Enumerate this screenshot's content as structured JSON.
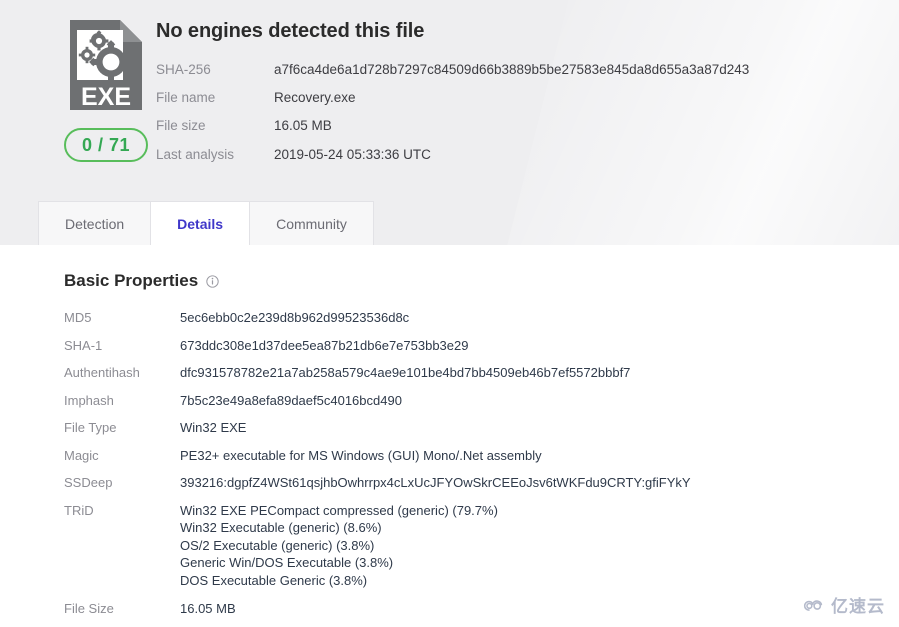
{
  "header": {
    "headline": "No engines detected this file",
    "file_icon_label": "EXE",
    "score": "0 / 71",
    "score_color": "#34a853",
    "meta": [
      {
        "key": "SHA-256",
        "value": "a7f6ca4de6a1d728b7297c84509d66b3889b5be27583e845da8d655a3a87d243"
      },
      {
        "key": "File name",
        "value": "Recovery.exe"
      },
      {
        "key": "File size",
        "value": "16.05 MB"
      },
      {
        "key": "Last analysis",
        "value": "2019-05-24 05:33:36 UTC"
      }
    ]
  },
  "tabs": [
    {
      "label": "Detection",
      "active": false
    },
    {
      "label": "Details",
      "active": true
    },
    {
      "label": "Community",
      "active": false
    }
  ],
  "tab_active_color": "#3f37c9",
  "details": {
    "section_title": "Basic Properties",
    "info_icon": "info-icon",
    "properties": [
      {
        "key": "MD5",
        "value": "5ec6ebb0c2e239d8b962d99523536d8c"
      },
      {
        "key": "SHA-1",
        "value": "673ddc308e1d37dee5ea87b21db6e7e753bb3e29"
      },
      {
        "key": "Authentihash",
        "value": "dfc931578782e21a7ab258a579c4ae9e101be4bd7bb4509eb46b7ef5572bbbf7"
      },
      {
        "key": "Imphash",
        "value": "7b5c23e49a8efa89daef5c4016bcd490"
      },
      {
        "key": "File Type",
        "value": "Win32 EXE"
      },
      {
        "key": "Magic",
        "value": "PE32+ executable for MS Windows (GUI) Mono/.Net assembly"
      },
      {
        "key": "SSDeep",
        "value": "393216:dgpfZ4WSt61qsjhbOwhrrpx4cLxUcJFYOwSkrCEEoJsv6tWKFdu9CRTY:gfiFYkY"
      }
    ],
    "trid_key": "TRiD",
    "trid_values": [
      "Win32 EXE PECompact compressed (generic) (79.7%)",
      "Win32 Executable (generic) (8.6%)",
      "OS/2 Executable (generic) (3.8%)",
      "Generic Win/DOS Executable (3.8%)",
      "DOS Executable Generic (3.8%)"
    ],
    "file_size_key": "File Size",
    "file_size_value": "16.05 MB"
  },
  "watermark": {
    "text": "亿速云",
    "icon": "cloud-icon"
  }
}
